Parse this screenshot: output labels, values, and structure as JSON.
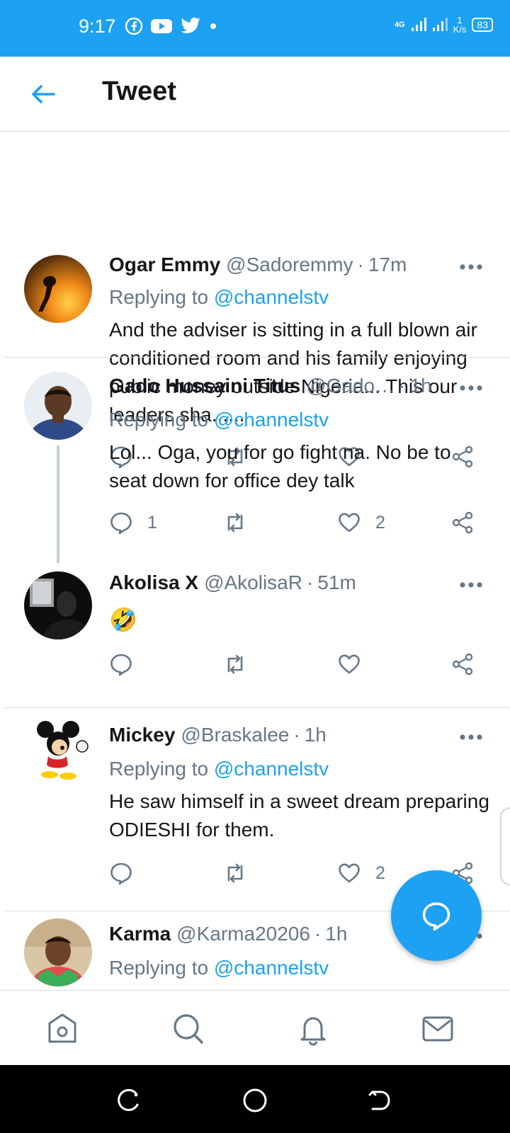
{
  "status_bar": {
    "time": "9:17",
    "network": "4G",
    "speed_value": "1",
    "speed_unit": "K/s",
    "battery": "83"
  },
  "header": {
    "title": "Tweet"
  },
  "tweets": [
    {
      "name": "Ogar Emmy",
      "handle": "@Sadoremmy",
      "time": "17m",
      "replying_prefix": "Replying to",
      "replying_mention": "@channelstv",
      "text": "And the adviser is sitting in a full blown air conditioned room and his family enjoying public money outside Nigeria... This our leaders sha......",
      "reply_count": "",
      "like_count": ""
    },
    {
      "name": "Gado Hussaini Titus",
      "handle": "@Gado…",
      "time": "1h",
      "replying_prefix": "Replying to",
      "replying_mention": "@channelstv",
      "text": "Lol... Oga, you for go fight na. No be to seat down for office dey talk",
      "reply_count": "1",
      "like_count": "2"
    },
    {
      "name": "Akolisa X",
      "handle": "@AkolisaR",
      "time": "51m",
      "text": "🤣",
      "reply_count": "",
      "like_count": ""
    },
    {
      "name": "Mickey",
      "handle": "@Braskalee",
      "time": "1h",
      "replying_prefix": "Replying to",
      "replying_mention": "@channelstv",
      "text": "He saw himself in a sweet dream preparing ODIESHI for them.",
      "reply_count": "",
      "like_count": "2"
    },
    {
      "name": "Karma",
      "handle": "@Karma20206",
      "time": "1h",
      "replying_prefix": "Replying to",
      "replying_mention": "@channelstv"
    }
  ],
  "colors": {
    "brand": "#1da1f2",
    "text": "#14171a",
    "muted": "#657786",
    "divider": "#d9dde0"
  },
  "icons": {
    "reply": "comment-icon",
    "retweet": "retweet-icon",
    "like": "heart-icon",
    "share": "share-icon",
    "nav": [
      "home-icon",
      "search-icon",
      "bell-icon",
      "mail-icon"
    ]
  }
}
